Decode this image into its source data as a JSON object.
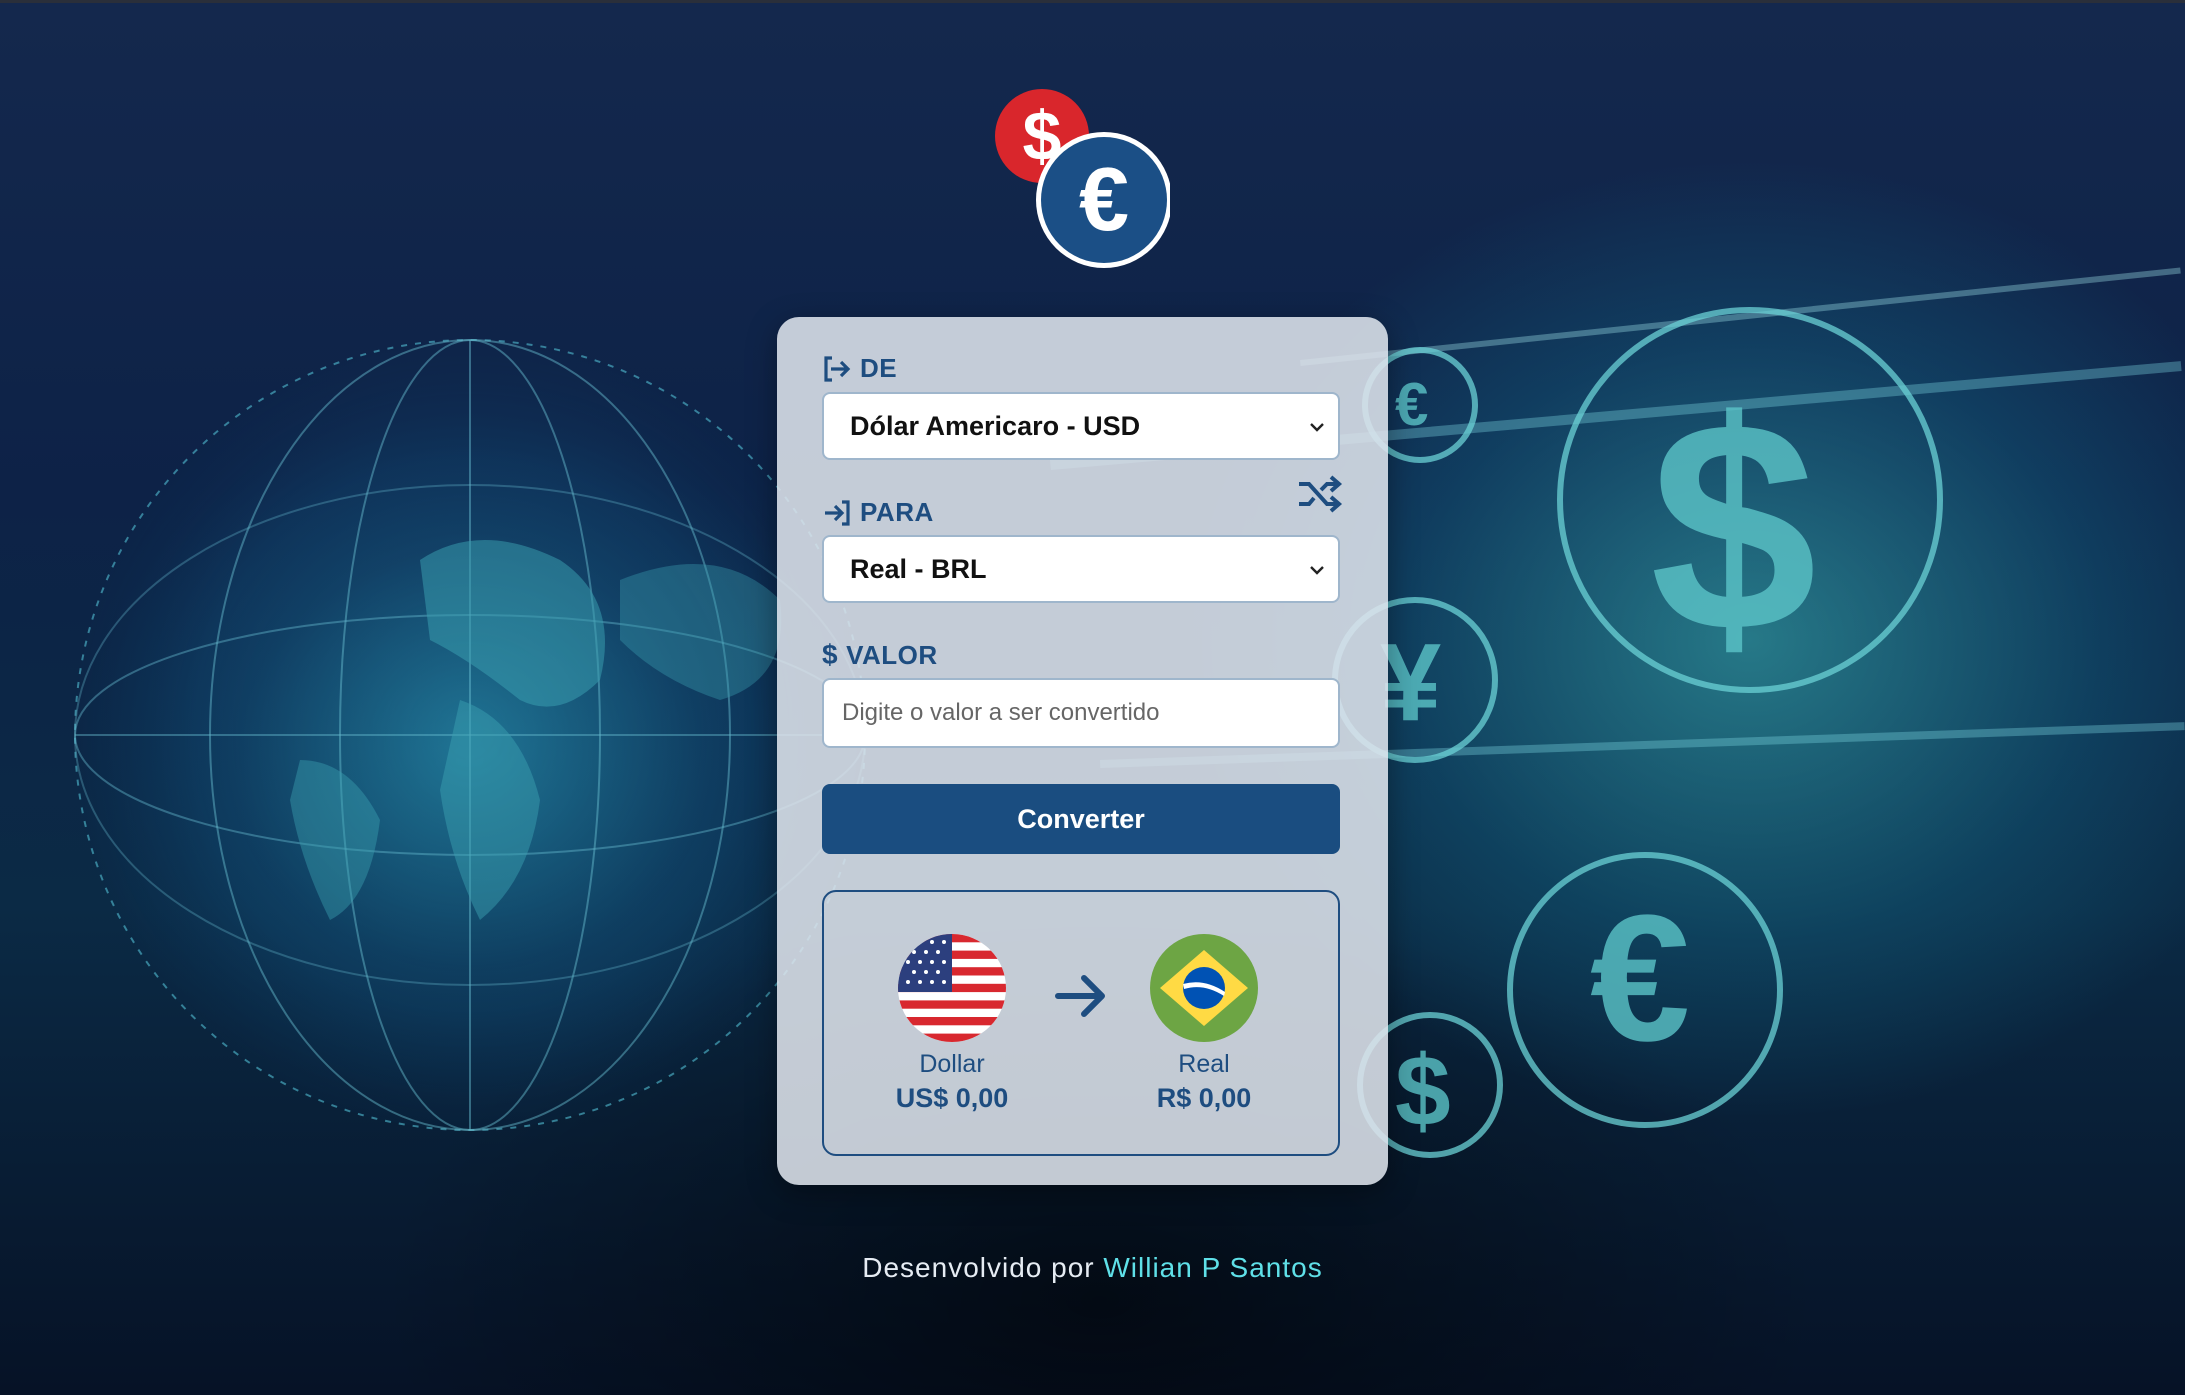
{
  "form": {
    "from_label": "DE",
    "from_value": "Dólar Americaro - USD",
    "to_label": "PARA",
    "to_value": "Real - BRL",
    "amount_label": "VALOR",
    "amount_placeholder": "Digite o valor a ser convertido",
    "amount_value": "",
    "convert_button": "Converter"
  },
  "result": {
    "from_currency_name": "Dollar",
    "from_currency_value": "US$ 0,00",
    "to_currency_name": "Real",
    "to_currency_value": "R$ 0,00"
  },
  "footer": {
    "prefix": "Desenvolvido por",
    "author": "Willian P Santos"
  },
  "icons": {
    "logo": "dollar-euro-coins-icon",
    "from": "sign-out-arrow-icon",
    "to": "sign-in-arrow-icon",
    "amount": "dollar-sign-icon",
    "swap": "shuffle-icon",
    "convert_arrow": "arrow-right-icon",
    "from_flag": "usa-flag-icon",
    "to_flag": "brazil-flag-icon"
  },
  "colors": {
    "accent": "#1a4d80",
    "author_link": "#5fe0e8",
    "dollar_coin": "#d9262c",
    "euro_coin": "#1b4f86"
  }
}
